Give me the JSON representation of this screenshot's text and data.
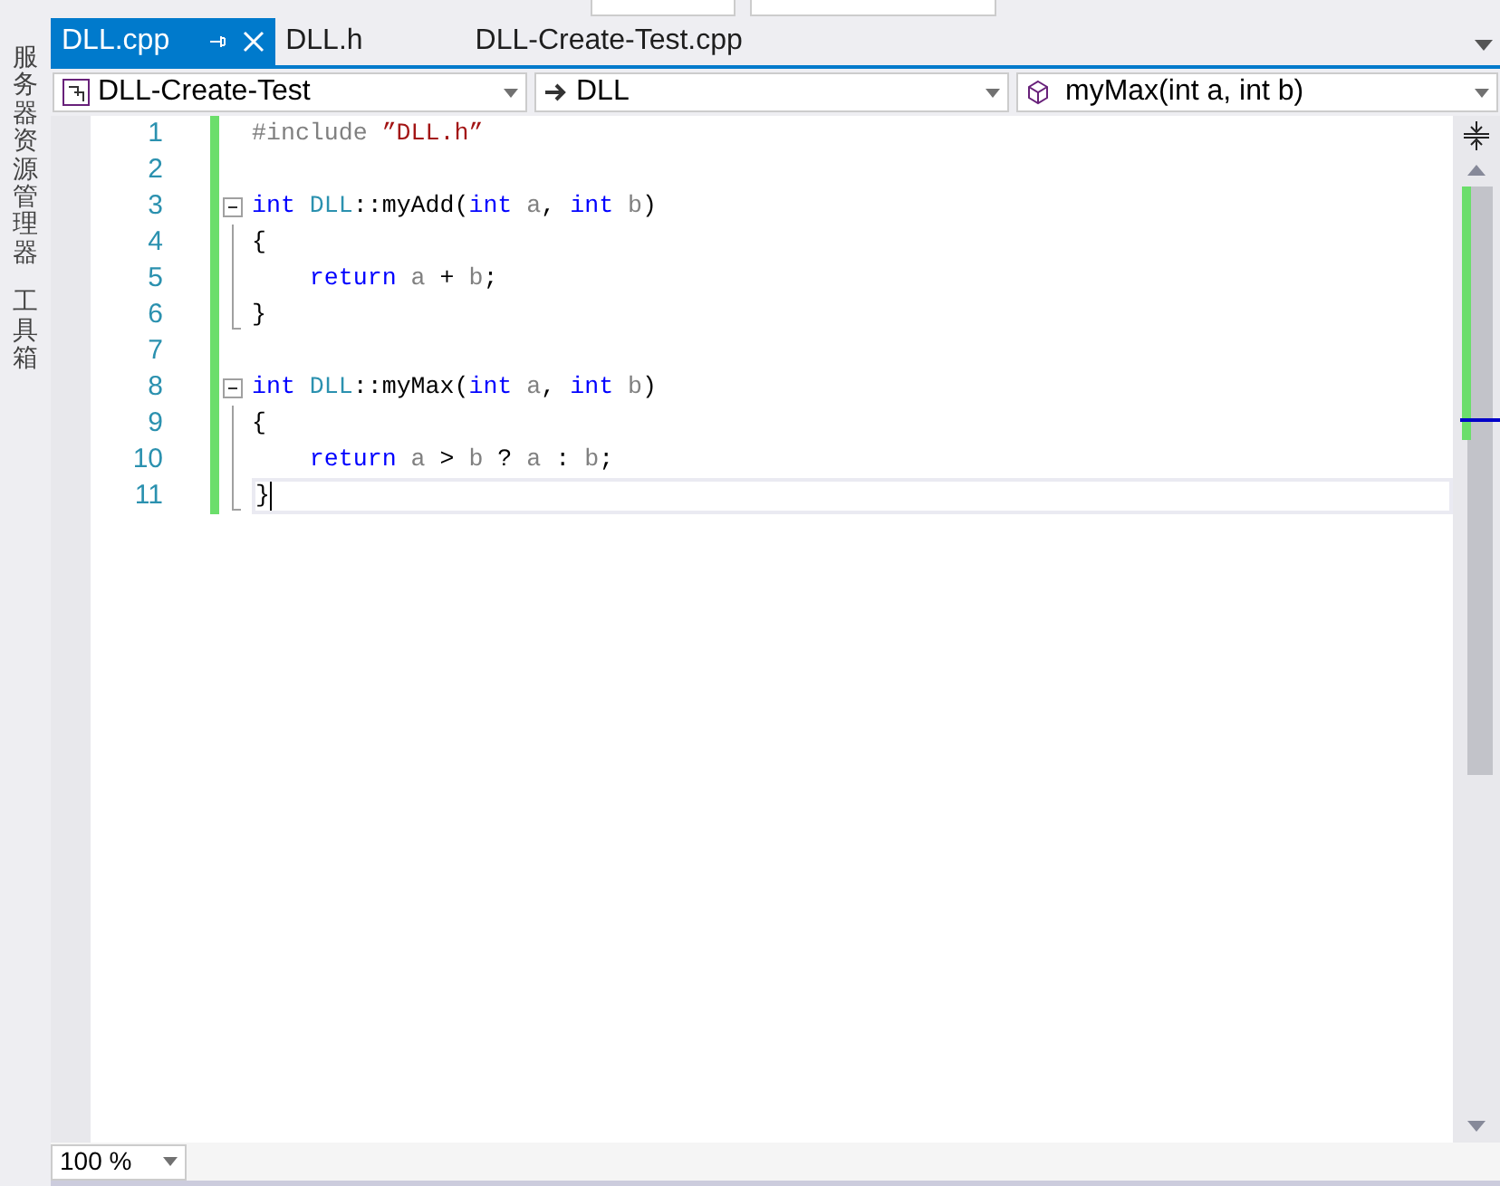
{
  "side_tabs": [
    "服务器资源管理器",
    "工具箱"
  ],
  "tabs": [
    {
      "label": "DLL.cpp",
      "selected": true
    },
    {
      "label": "DLL.h",
      "selected": false
    },
    {
      "label": "DLL-Create-Test.cpp",
      "selected": false
    }
  ],
  "nav": {
    "project": "DLL-Create-Test",
    "scope": "DLL",
    "member": "myMax(int a, int b)"
  },
  "lines": [
    {
      "number": "1",
      "kind": "plain",
      "current": false,
      "tokens": [
        {
          "kind": "preprocessor",
          "text": "#include"
        },
        {
          "kind": "string",
          "text": " ”DLL.h”"
        }
      ]
    },
    {
      "number": "2",
      "kind": "plain",
      "current": false
    },
    {
      "number": "3",
      "kind": "header",
      "current": false,
      "tokens": [
        {
          "kind": "keyword",
          "text": "int"
        },
        {
          "kind": "type",
          "text": " DLL"
        },
        {
          "kind": "plain",
          "text": "::myAdd("
        },
        {
          "kind": "keyword",
          "text": "int"
        },
        {
          "kind": "param",
          "text": " a"
        },
        {
          "kind": "plain",
          "text": ", "
        },
        {
          "kind": "keyword",
          "text": "int"
        },
        {
          "kind": "param",
          "text": " b"
        },
        {
          "kind": "plain",
          "text": ")"
        }
      ]
    },
    {
      "number": "4",
      "kind": "body",
      "current": false,
      "tokens": [
        {
          "kind": "plain",
          "text": "{"
        }
      ]
    },
    {
      "number": "5",
      "kind": "body",
      "current": false,
      "tokens": [
        {
          "kind": "keyword",
          "text": "    return"
        },
        {
          "kind": "param",
          "text": " a"
        },
        {
          "kind": "plain",
          "text": " + "
        },
        {
          "kind": "param",
          "text": "b"
        },
        {
          "kind": "plain",
          "text": ";"
        }
      ]
    },
    {
      "number": "6",
      "kind": "closer",
      "current": false,
      "tokens": [
        {
          "kind": "plain",
          "text": "}"
        }
      ]
    },
    {
      "number": "7",
      "kind": "plain",
      "current": false
    },
    {
      "number": "8",
      "kind": "header",
      "current": false,
      "tokens": [
        {
          "kind": "keyword",
          "text": "int"
        },
        {
          "kind": "type",
          "text": " DLL"
        },
        {
          "kind": "plain",
          "text": "::myMax("
        },
        {
          "kind": "keyword",
          "text": "int"
        },
        {
          "kind": "param",
          "text": " a"
        },
        {
          "kind": "plain",
          "text": ", "
        },
        {
          "kind": "keyword",
          "text": "int"
        },
        {
          "kind": "param",
          "text": " b"
        },
        {
          "kind": "plain",
          "text": ")"
        }
      ]
    },
    {
      "number": "9",
      "kind": "body",
      "current": false,
      "tokens": [
        {
          "kind": "plain",
          "text": "{"
        }
      ]
    },
    {
      "number": "10",
      "kind": "body",
      "current": false,
      "tokens": [
        {
          "kind": "keyword",
          "text": "    return"
        },
        {
          "kind": "param",
          "text": " a"
        },
        {
          "kind": "plain",
          "text": " > "
        },
        {
          "kind": "param",
          "text": "b"
        },
        {
          "kind": "plain",
          "text": " ? "
        },
        {
          "kind": "param",
          "text": "a"
        },
        {
          "kind": "plain",
          "text": " : "
        },
        {
          "kind": "param",
          "text": "b"
        },
        {
          "kind": "plain",
          "text": ";"
        }
      ]
    },
    {
      "number": "11",
      "kind": "closer",
      "current": true,
      "tokens": [
        {
          "kind": "plain",
          "text": "}"
        }
      ]
    }
  ],
  "zoom": "100 %"
}
